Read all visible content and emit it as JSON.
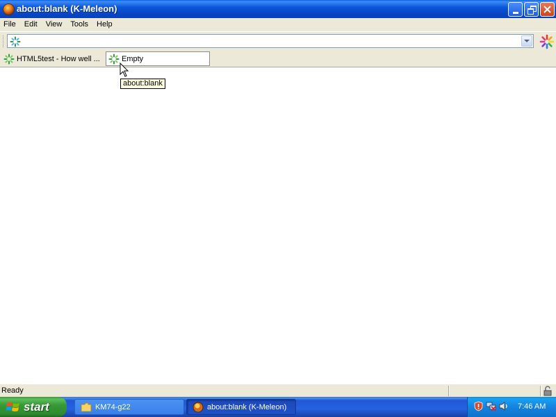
{
  "window": {
    "title": "about:blank (K-Meleon)",
    "icon": "k-meleon-icon"
  },
  "menu": [
    "File",
    "Edit",
    "View",
    "Tools",
    "Help"
  ],
  "address_bar": {
    "value": "",
    "icon": "loading-spinner-icon"
  },
  "tabs": [
    {
      "label": "HTML5test - How well ...",
      "active": false
    },
    {
      "label": "Empty",
      "active": true
    }
  ],
  "tooltip": "about:blank",
  "status": {
    "text": "Ready"
  },
  "taskbar": {
    "start_label": "start",
    "tasks": [
      {
        "label": "KM74-g22",
        "icon": "folder-icon",
        "active": false
      },
      {
        "label": "about:blank (K-Meleon)",
        "icon": "k-meleon-icon",
        "active": true
      }
    ],
    "clock": "7:46 AM"
  },
  "colors": {
    "titlebar_blue": "#0b56d8",
    "taskbar_blue": "#2663e0",
    "start_green": "#379a37",
    "tray_blue": "#1583e0",
    "chrome": "#ece9d8"
  }
}
